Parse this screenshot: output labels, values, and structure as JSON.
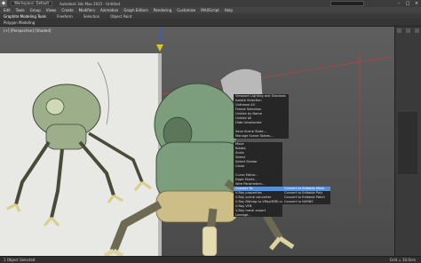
{
  "titlebar": {
    "workspace": "Workspace: Default",
    "title": "Autodesk 3ds Max 2015 - Untitled",
    "window_buttons": [
      "minimize-icon",
      "maximize-icon",
      "close-icon"
    ]
  },
  "menubar": {
    "items": [
      "Edit",
      "Tools",
      "Group",
      "Views",
      "Create",
      "Modifiers",
      "Animation",
      "Graph Editors",
      "Rendering",
      "Customize",
      "MAXScript",
      "Help"
    ]
  },
  "toolbar": {
    "tabs": [
      "Graphite Modeling Tools",
      "Freeform",
      "Selection",
      "Object Paint"
    ]
  },
  "ribbon": {
    "panel_label": "Polygon Modeling"
  },
  "viewport": {
    "label": "[+] [Perspective] [Shaded]"
  },
  "quad_menu": {
    "left_top": [],
    "right_top": [
      "Viewport Lighting and Shadows",
      "Isolate Selection",
      "Unfreeze All",
      "Freeze Selection",
      "Unhide by Name",
      "Unhide All",
      "Hide Unselected",
      "",
      "Save Scene State...",
      "Manage Scene States..."
    ],
    "right_bottom": [
      "Move",
      "Rotate",
      "Scale",
      "Select",
      "Select Similar",
      "Clone",
      "",
      "Curve Editor...",
      "Dope Sheet...",
      "Wire Parameters...",
      "Convert To:",
      "V-Ray properties",
      "V-Ray scene converter",
      "V-Ray Bitmap to VRayHDRI converter",
      "V-Ray VFB",
      "V-Ray mesh export",
      "Lineage...",
      "Unresolve animation expander"
    ],
    "submenu": [
      "Convert to Editable Mesh",
      "Convert to Editable Poly",
      "Convert to Editable Patch",
      "Convert to NURBS"
    ]
  },
  "statusbar": {
    "left": "1 Object Selected",
    "right": "Grid = 10.0cm"
  },
  "colors": {
    "highlight": "#5a8fd6",
    "model": "#7d9e7c",
    "background": "#4a4a4a"
  }
}
